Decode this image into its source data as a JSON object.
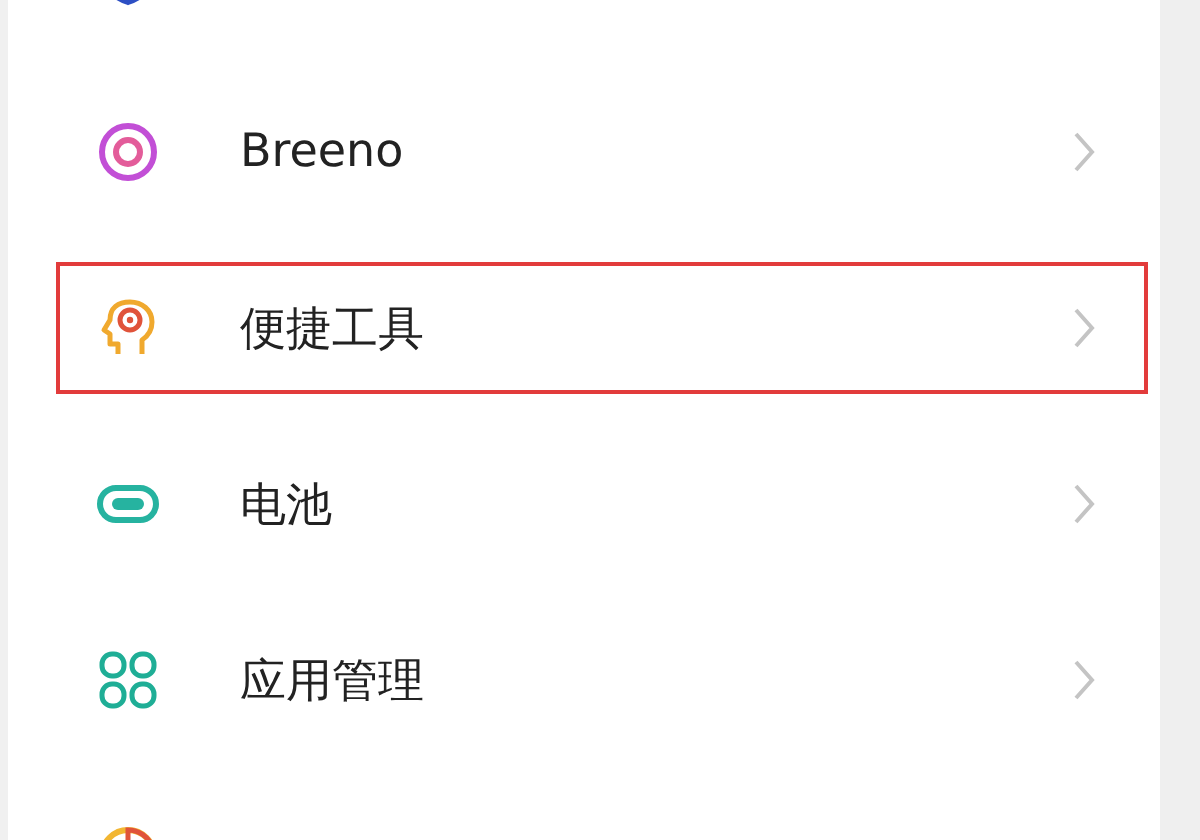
{
  "settings_items": [
    {
      "kind": "shield",
      "highlighted": false
    },
    {
      "kind": "rings",
      "label": "Breeno",
      "highlighted": false
    },
    {
      "kind": "head",
      "label": "便捷工具",
      "highlighted": true
    },
    {
      "kind": "battery",
      "label": "电池",
      "highlighted": false
    },
    {
      "kind": "grid",
      "label": "应用管理",
      "highlighted": false
    },
    {
      "kind": "pie",
      "highlighted": false
    }
  ]
}
